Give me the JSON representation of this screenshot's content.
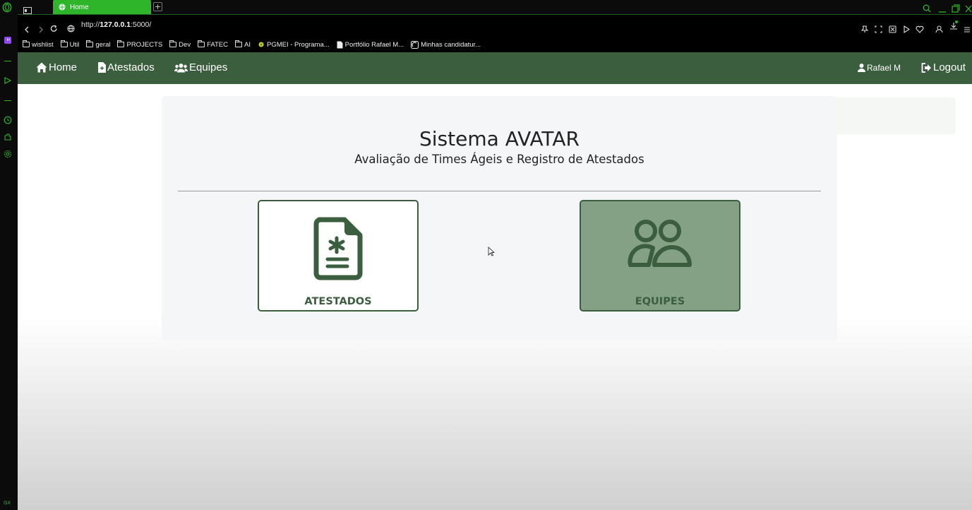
{
  "browser": {
    "tab_title": "Home",
    "new_tab": "+",
    "url_prefix": "http://",
    "url_host": "127.0.0.1",
    "url_rest": ":5000/",
    "accent_color": "#2fb52a"
  },
  "bookmarks": [
    {
      "label": "wishlist",
      "icon": "folder-icon"
    },
    {
      "label": "Util",
      "icon": "folder-icon"
    },
    {
      "label": "geral",
      "icon": "folder-icon"
    },
    {
      "label": "PROJECTS",
      "icon": "folder-icon"
    },
    {
      "label": "Dev",
      "icon": "folder-icon"
    },
    {
      "label": "FATEC",
      "icon": "folder-icon"
    },
    {
      "label": "AI",
      "icon": "folder-icon"
    },
    {
      "label": "PGMEI - Programa...",
      "icon": "site-icon"
    },
    {
      "label": "Portfólio Rafael M...",
      "icon": "document-icon"
    },
    {
      "label": "Minhas candidatur...",
      "icon": "site-icon"
    }
  ],
  "navbar": {
    "home": "Home",
    "atestados": "Atestados",
    "equipes": "Equipes",
    "user": "Rafael M",
    "logout": "Logout",
    "color": "#3b5e3e"
  },
  "main": {
    "title": "Sistema AVATAR",
    "subtitle": "Avaliação de Times Ágeis e Registro de Atestados",
    "tiles": {
      "atestados": "ATESTADOS",
      "equipes": "EQUIPES"
    }
  }
}
